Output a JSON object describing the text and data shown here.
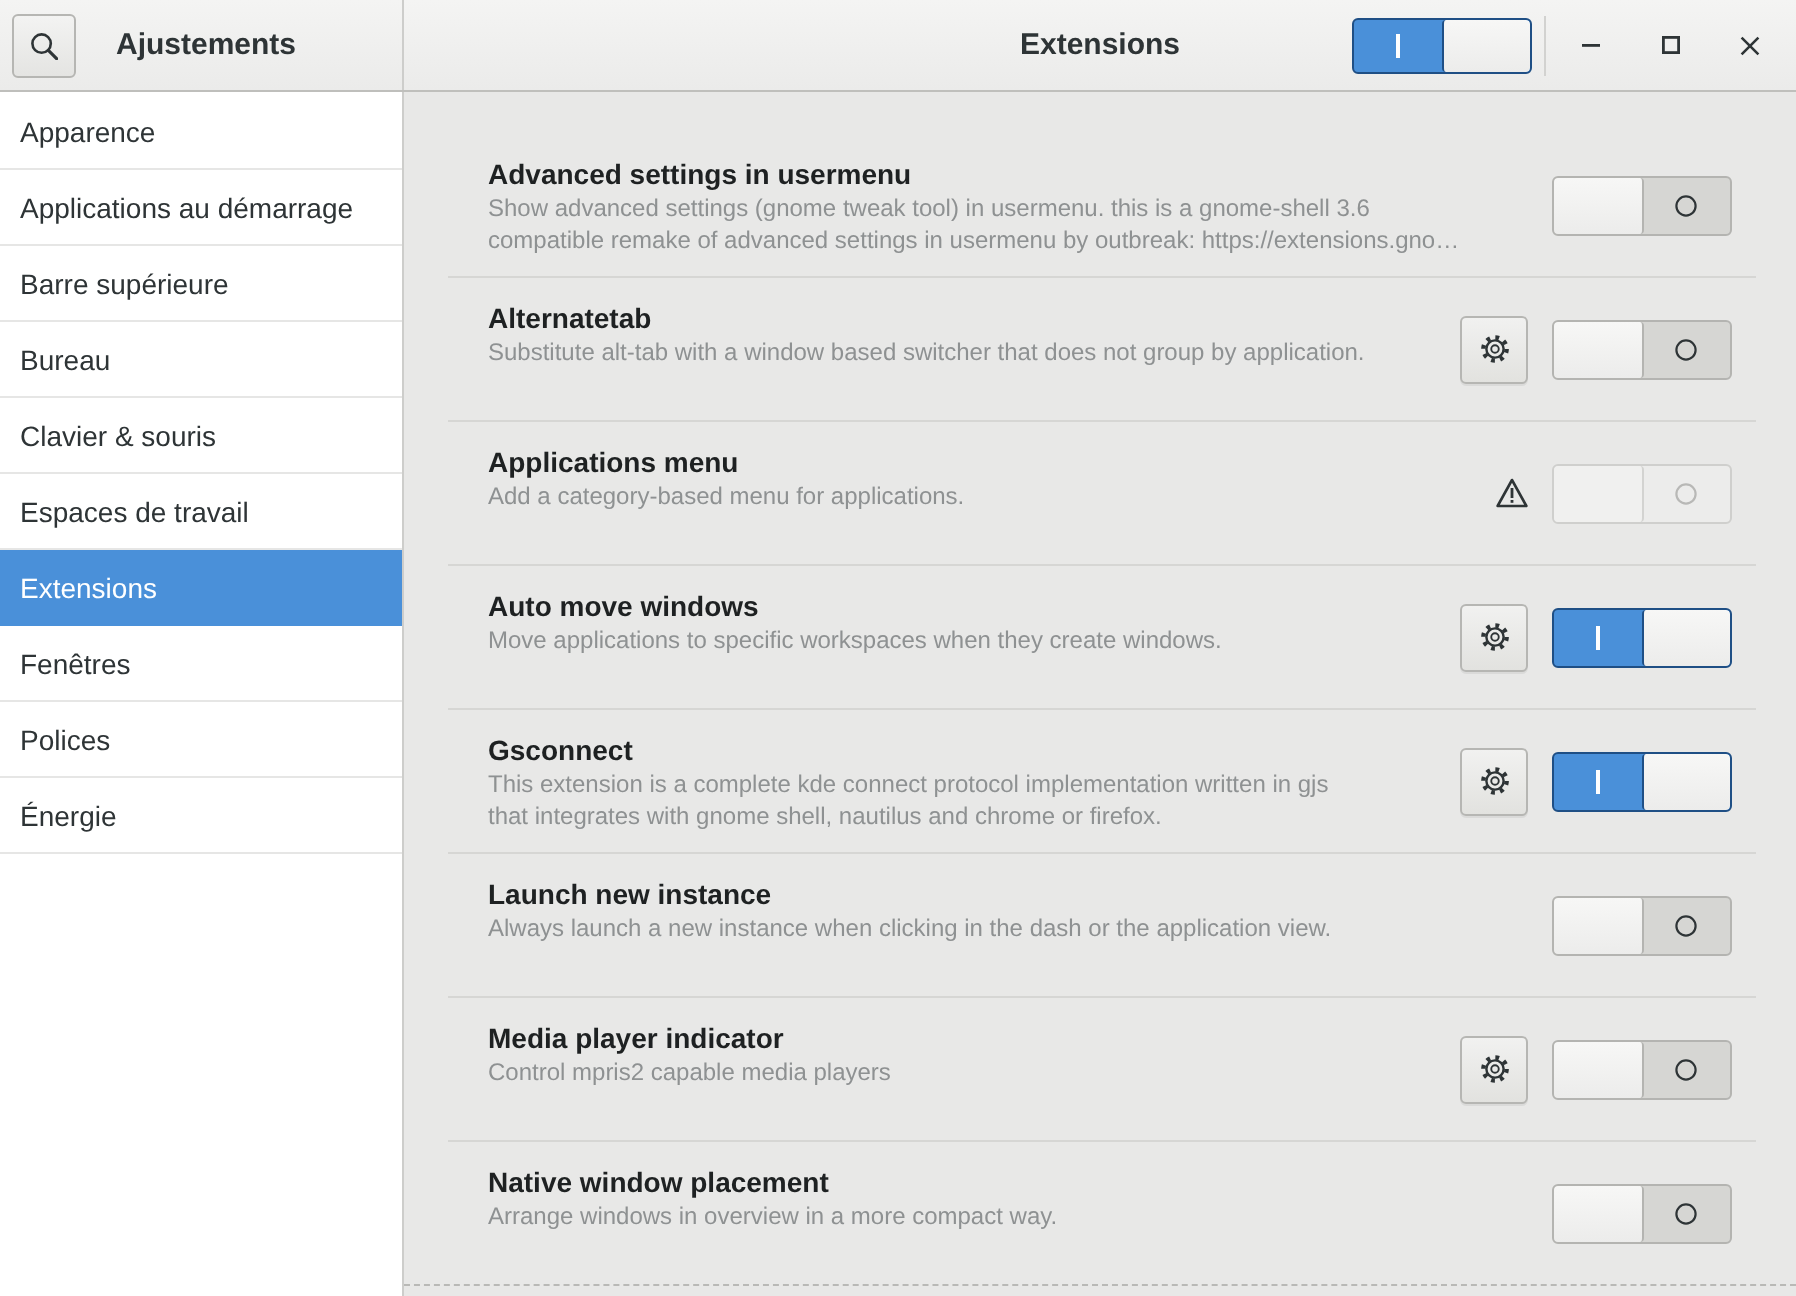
{
  "window": {
    "title": "Ajustements",
    "page_title": "Extensions"
  },
  "header": {
    "global_switch": {
      "on": true
    }
  },
  "sidebar": {
    "items": [
      {
        "label": "Apparence",
        "selected": false
      },
      {
        "label": "Applications au démarrage",
        "selected": false
      },
      {
        "label": "Barre supérieure",
        "selected": false
      },
      {
        "label": "Bureau",
        "selected": false
      },
      {
        "label": "Clavier & souris",
        "selected": false
      },
      {
        "label": "Espaces de travail",
        "selected": false
      },
      {
        "label": "Extensions",
        "selected": true
      },
      {
        "label": "Fenêtres",
        "selected": false
      },
      {
        "label": "Polices",
        "selected": false
      },
      {
        "label": "Énergie",
        "selected": false
      }
    ]
  },
  "extensions": [
    {
      "name": "Advanced settings in usermenu",
      "description": "Show advanced settings (gnome tweak tool) in usermenu. this is a gnome-shell 3.6\ncompatible remake of advanced settings in usermenu by outbreak: https://extensions.gno…",
      "settings": false,
      "warning": false,
      "on": false,
      "disabled": false
    },
    {
      "name": "Alternatetab",
      "description": "Substitute alt-tab with a window based switcher that does not group by application.",
      "settings": true,
      "warning": false,
      "on": false,
      "disabled": false
    },
    {
      "name": "Applications menu",
      "description": "Add a category-based menu for applications.",
      "settings": false,
      "warning": true,
      "on": false,
      "disabled": true
    },
    {
      "name": "Auto move windows",
      "description": "Move applications to specific workspaces when they create windows.",
      "settings": true,
      "warning": false,
      "on": true,
      "disabled": false
    },
    {
      "name": "Gsconnect",
      "description": "This extension is a complete kde connect protocol implementation written in gjs\nthat integrates with gnome shell, nautilus and chrome or firefox.",
      "settings": true,
      "warning": false,
      "on": true,
      "disabled": false
    },
    {
      "name": "Launch new instance",
      "description": "Always launch a new instance when clicking in the dash or the application view.",
      "settings": false,
      "warning": false,
      "on": false,
      "disabled": false
    },
    {
      "name": "Media player indicator",
      "description": "Control mpris2 capable media players",
      "settings": true,
      "warning": false,
      "on": false,
      "disabled": false
    },
    {
      "name": "Native window placement",
      "description": "Arrange windows in overview in a more compact way.",
      "settings": false,
      "warning": false,
      "on": false,
      "disabled": false
    }
  ]
}
